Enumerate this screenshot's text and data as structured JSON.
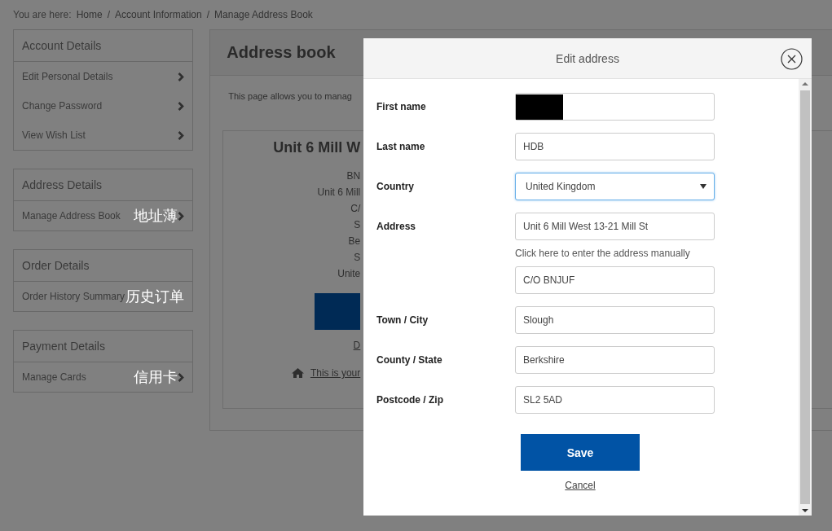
{
  "breadcrumb": {
    "prefix": "You are here:",
    "separator": "/",
    "items": [
      "Home",
      "Account Information",
      "Manage Address Book"
    ]
  },
  "sidebar": {
    "groups": [
      {
        "title": "Account Details",
        "items": [
          {
            "label": "Edit Personal Details",
            "arrow": true
          },
          {
            "label": "Change Password",
            "arrow": true
          },
          {
            "label": "View Wish List",
            "arrow": true
          }
        ]
      },
      {
        "title": "Address Details",
        "items": [
          {
            "label": "Manage Address Book",
            "arrow": true,
            "note": "地址薄"
          }
        ]
      },
      {
        "title": "Order Details",
        "items": [
          {
            "label": "Order History Summary",
            "arrow": false,
            "note": "历史订单"
          }
        ]
      },
      {
        "title": "Payment Details",
        "items": [
          {
            "label": "Manage Cards",
            "arrow": true,
            "note": "信用卡"
          }
        ]
      }
    ]
  },
  "main": {
    "title": "Address book",
    "intro": "This page allows you to manag",
    "card": {
      "heading": "Unit 6 Mill W",
      "lines": [
        "BN",
        "Unit 6 Mill",
        "C/",
        "S",
        "Be",
        "S",
        "Unite"
      ],
      "link": "D",
      "default_note": "This is your"
    }
  },
  "modal": {
    "title": "Edit address",
    "fields": [
      {
        "label": "First name",
        "kind": "text",
        "redacted": true,
        "focused": false
      },
      {
        "label": "Last name",
        "kind": "text",
        "value": "HDB",
        "focused": false
      },
      {
        "label": "Country",
        "kind": "select",
        "value": "United Kingdom",
        "focused": true
      },
      {
        "label": "Address",
        "kind": "text",
        "value": "Unit 6 Mill West 13-21 Mill St",
        "focused": false
      },
      {
        "kind": "link",
        "text": "Click here to enter the address manually"
      },
      {
        "kind": "text",
        "value": "C/O BNJUF",
        "focused": false
      },
      {
        "label": "Town / City",
        "kind": "text",
        "value": "Slough",
        "focused": false
      },
      {
        "label": "County / State",
        "kind": "text",
        "value": "Berkshire",
        "focused": false
      },
      {
        "label": "Postcode / Zip",
        "kind": "text",
        "value": "SL2 5AD",
        "focused": false
      }
    ],
    "save": "Save",
    "cancel": "Cancel"
  }
}
